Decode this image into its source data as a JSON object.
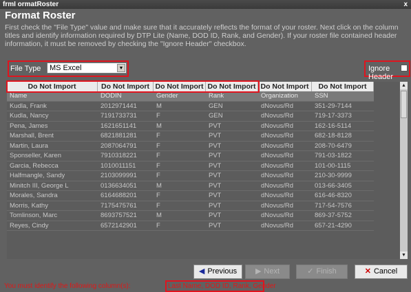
{
  "window": {
    "title": "frmI ormatRoster",
    "close_label": "x"
  },
  "heading": "Format Roster",
  "instructions": "First check the \"File Type\" value and make sure that it accurately reflects the format of your roster. Next click on the column titles and identify information required by DTP Lite (Name, DOD ID, Rank, and Gender). If your roster file contained header information, it must be removed by checking the \"Ignore Header\" checkbox.",
  "file_type": {
    "label": "File Type",
    "value": "MS Excel"
  },
  "ignore_header": {
    "label": "Ignore Header",
    "checked": false
  },
  "columns": [
    "Do Not Import",
    "Do Not Import",
    "Do Not Import",
    "Do Not Import",
    "Do Not Import",
    "Do Not Import"
  ],
  "rows": [
    [
      "Name",
      "DODIN",
      "Gender",
      "Rank",
      "Organization",
      "SSN"
    ],
    [
      "Kudla, Frank",
      "2012971441",
      "M",
      "GEN",
      "dNovus/Rd",
      "351-29-7144"
    ],
    [
      "Kudla, Nancy",
      "7191733731",
      "F",
      "GEN",
      "dNovus/Rd",
      "719-17-3373"
    ],
    [
      "Pena, James",
      "1621651141",
      "M",
      "PVT",
      "dNovus/Rd",
      "162-16-5114"
    ],
    [
      "Marshall, Brent",
      "6821881281",
      "F",
      "PVT",
      "dNovus/Rd",
      "682-18-8128"
    ],
    [
      "Martin, Laura",
      "2087064791",
      "F",
      "PVT",
      "dNovus/Rd",
      "208-70-6479"
    ],
    [
      "Sponseller, Karen",
      "7910318221",
      "F",
      "PVT",
      "dNovus/Rd",
      "791-03-1822"
    ],
    [
      "Garcia, Rebecca",
      "1010011151",
      "F",
      "PVT",
      "dNovus/Rd",
      "101-00-1115"
    ],
    [
      "Halfmangle, Sandy",
      "2103099991",
      "F",
      "PVT",
      "dNovus/Rd",
      "210-30-9999"
    ],
    [
      "Minitch III, George L",
      "0136634051",
      "M",
      "PVT",
      "dNovus/Rd",
      "013-66-3405"
    ],
    [
      "Morales, Sandra",
      "6164688201",
      "F",
      "PVT",
      "dNovus/Rd",
      "616-46-8320"
    ],
    [
      "Morris, Kathy",
      "7175475761",
      "F",
      "PVT",
      "dNovus/Rd",
      "717-54-7576"
    ],
    [
      "Tomlinson, Marc",
      "8693757521",
      "M",
      "PVT",
      "dNovus/Rd",
      "869-37-5752"
    ],
    [
      "Reyes, Cindy",
      "6572142901",
      "F",
      "PVT",
      "dNovus/Rd",
      "657-21-4290"
    ]
  ],
  "buttons": {
    "previous": "Previous",
    "next": "Next",
    "finish": "Finish",
    "cancel": "Cancel"
  },
  "footer": {
    "message": "You must identify the following column(s):",
    "required_columns": "Last Name, DOD ID, Rank, Gender"
  },
  "colors": {
    "accent_red": "#e0141e",
    "background": "#616161",
    "header_bg": "#ebebeb"
  }
}
